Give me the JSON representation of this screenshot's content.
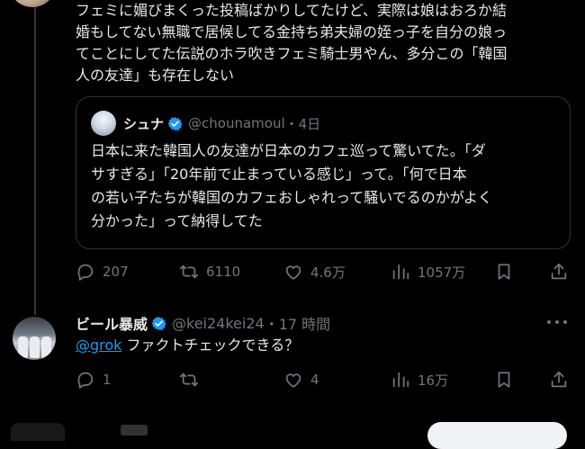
{
  "top_post": {
    "text": "フェミに媚びまくった投稿ばかりしてたけど、実際は娘はおろか結\n婚もしてない無職で居候してる金持ち弟夫婦の姪っ子を自分の娘っ\nてことにしてた伝説のホラ吹きフェミ騎士男やん、多分この「韓国\n人の友達」も存在しない"
  },
  "quote": {
    "name": "シュナ",
    "handle": "@chounamoul",
    "time": "・4日",
    "text": "日本に来た韓国人の友達が日本のカフェ巡って驚いてた。「ダ\nサすぎる」「20年前で止まっている感じ」って。「何で日本\nの若い子たちが韓国のカフェおしゃれって騒いでるのかがよく\n分かった」って納得してた"
  },
  "top_actions": {
    "replies": "207",
    "reposts": "6110",
    "likes": "4.6万",
    "views": "1057万"
  },
  "reply": {
    "name": "ビール暴威",
    "handle": "@kei24kei24",
    "time": "・17 時間",
    "mention": "@grok",
    "text": " ファクトチェックできる？",
    "actions": {
      "replies": "1",
      "reposts": "",
      "likes": "4",
      "views": "16万"
    }
  },
  "colors": {
    "background": "#000000",
    "text": "#e7e9ea",
    "muted": "#71767b",
    "accent": "#1d9bf0",
    "border": "#2f3336"
  },
  "icons": [
    "reply-icon",
    "repost-icon",
    "like-icon",
    "views-icon",
    "bookmark-icon",
    "share-icon",
    "verified-icon",
    "more-icon"
  ]
}
